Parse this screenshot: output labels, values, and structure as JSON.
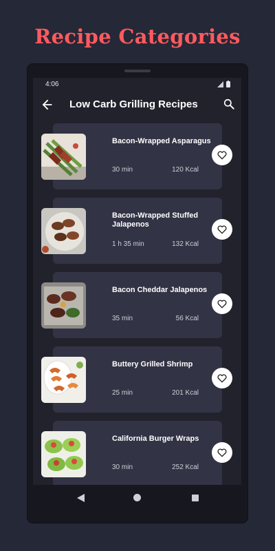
{
  "promo": {
    "title": "Recipe Categories"
  },
  "status_bar": {
    "time": "4:06"
  },
  "app_bar": {
    "title": "Low Carb Grilling Recipes"
  },
  "recipes": [
    {
      "name": "Bacon-Wrapped Asparagus",
      "time": "30 min",
      "kcal": "120 Kcal"
    },
    {
      "name": "Bacon-Wrapped Stuffed Jalapenos",
      "time": "1 h 35 min",
      "kcal": "132 Kcal"
    },
    {
      "name": "Bacon Cheddar Jalapenos",
      "time": "35 min",
      "kcal": "56 Kcal"
    },
    {
      "name": "Buttery Grilled Shrimp",
      "time": "25 min",
      "kcal": "201 Kcal"
    },
    {
      "name": "California Burger Wraps",
      "time": "30 min",
      "kcal": "252 Kcal"
    }
  ],
  "colors": {
    "accent": "#ff5a5f",
    "background": "#252836",
    "card": "#333346"
  },
  "icons": [
    "back-arrow-icon",
    "search-icon",
    "heart-outline-icon",
    "wifi-icon",
    "battery-icon"
  ]
}
